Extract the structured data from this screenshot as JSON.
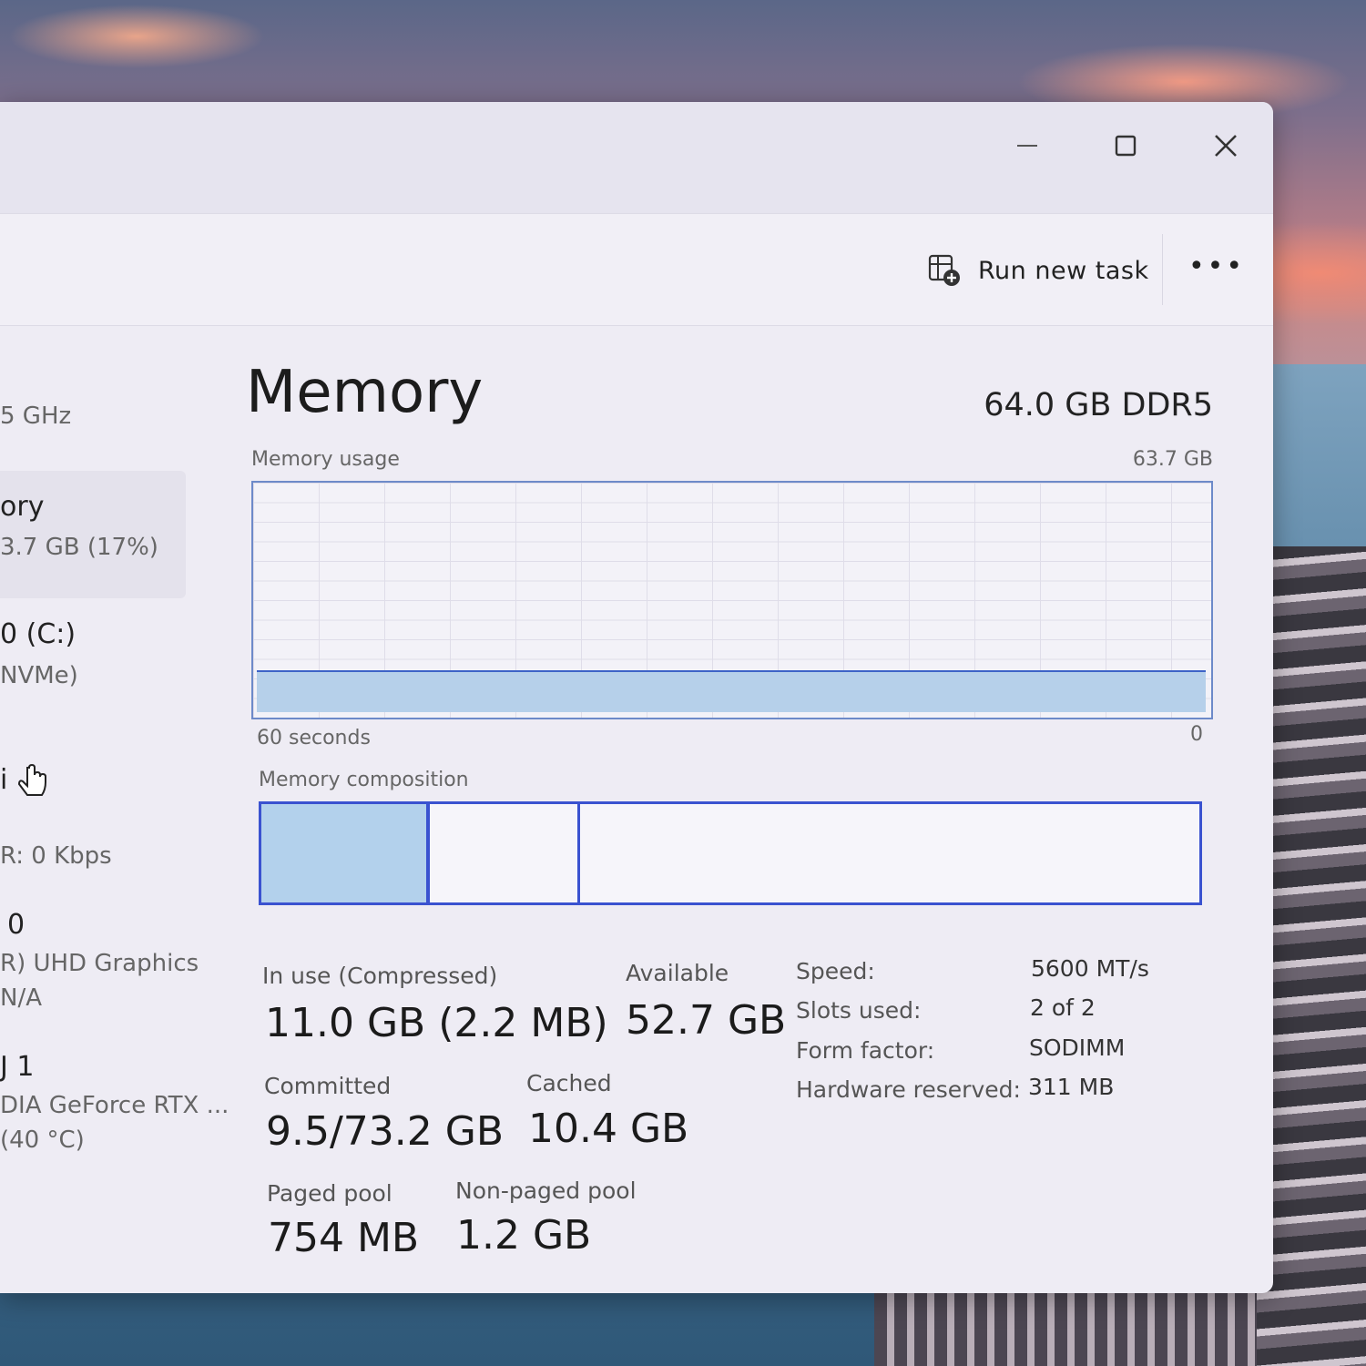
{
  "window": {
    "toolbar": {
      "run_new_task_label": "Run new task",
      "more_label": "•••"
    }
  },
  "sidebar": {
    "items": [
      {
        "main": "",
        "sub": "5 GHz"
      },
      {
        "main": "ory",
        "sub": "3.7 GB (17%)"
      },
      {
        "main": "0 (C:)",
        "sub": "NVMe)"
      },
      {
        "main": "i",
        "sub": "R: 0 Kbps"
      },
      {
        "main": "0",
        "sub": "R) UHD Graphics",
        "sub2": "N/A"
      },
      {
        "main": "J 1",
        "sub": "DIA GeForce RTX ...",
        "sub2": "(40 °C)"
      }
    ]
  },
  "memory": {
    "title": "Memory",
    "total": "64.0 GB DDR5",
    "usage_label": "Memory usage",
    "usage_max": "63.7 GB",
    "time_left": "60 seconds",
    "time_right": "0",
    "usage_fraction": 0.17,
    "composition_label": "Memory composition",
    "composition": {
      "in_use_fraction": 0.18,
      "modified_fraction": 0.16
    },
    "stats": {
      "in_use_label": "In use (Compressed)",
      "in_use_value": "11.0 GB (2.2 MB)",
      "available_label": "Available",
      "available_value": "52.7 GB",
      "committed_label": "Committed",
      "committed_value": "9.5/73.2 GB",
      "cached_label": "Cached",
      "cached_value": "10.4 GB",
      "paged_label": "Paged pool",
      "paged_value": "754 MB",
      "nonpaged_label": "Non-paged pool",
      "nonpaged_value": "1.2 GB"
    },
    "specs": [
      {
        "label": "Speed:",
        "value": "5600 MT/s"
      },
      {
        "label": "Slots used:",
        "value": "2 of 2"
      },
      {
        "label": "Form factor:",
        "value": "SODIMM"
      },
      {
        "label": "Hardware reserved:",
        "value": "311 MB"
      }
    ]
  },
  "colors": {
    "accent": "#3a52d0",
    "fill": "#b6d0ea"
  }
}
